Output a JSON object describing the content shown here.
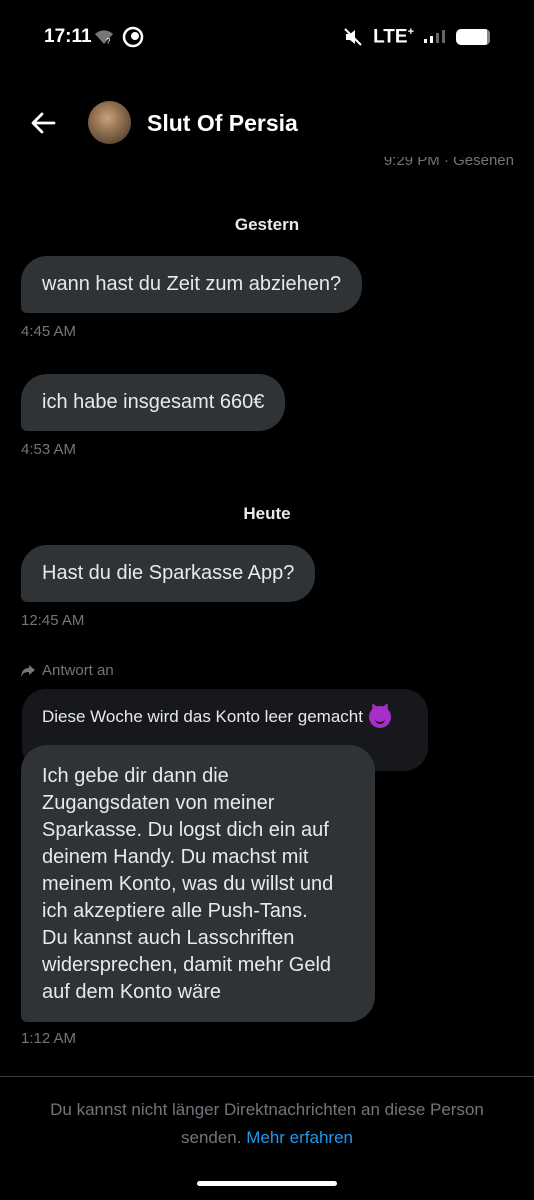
{
  "status_bar": {
    "time": "17:11",
    "network": "LTE",
    "network_plus": "+",
    "battery_percent": 90
  },
  "header": {
    "name": "Slut Of Persia",
    "prev_meta": "9:29 PM · Gesehen"
  },
  "conversation": {
    "sep_yesterday": "Gestern",
    "msg1": {
      "text": "wann hast du Zeit zum abziehen?",
      "time": "4:45 AM"
    },
    "msg2": {
      "text": "ich habe insgesamt 660€",
      "time": "4:53 AM"
    },
    "sep_today": "Heute",
    "msg3": {
      "text": "Hast du die Sparkasse App?",
      "time": "12:45 AM"
    },
    "reply_label": "Antwort an",
    "quoted_text": "Diese Woche wird das Konto leer gemacht",
    "quoted_emoji": "smiling-face-with-horns",
    "msg4": {
      "lines": [
        "Ich gebe dir dann die",
        "Zugangsdaten von meiner",
        "Sparkasse. Du logst dich ein auf",
        "deinem Handy. Du machst mit",
        "meinem Konto, was du willst und",
        "ich akzeptiere alle Push-Tans.",
        "Du kannst auch Lasschriften",
        "widersprechen, damit mehr Geld",
        "auf dem Konto wäre"
      ],
      "time": "1:12 AM"
    }
  },
  "footer": {
    "line1": "Du kannst nicht länger Direktnachrichten an diese Person",
    "line2": "senden.",
    "link": "Mehr erfahren"
  },
  "colors": {
    "background": "#000000",
    "bubble": "#2f3336",
    "link": "#1d9bf0",
    "muted": "#71767b"
  }
}
